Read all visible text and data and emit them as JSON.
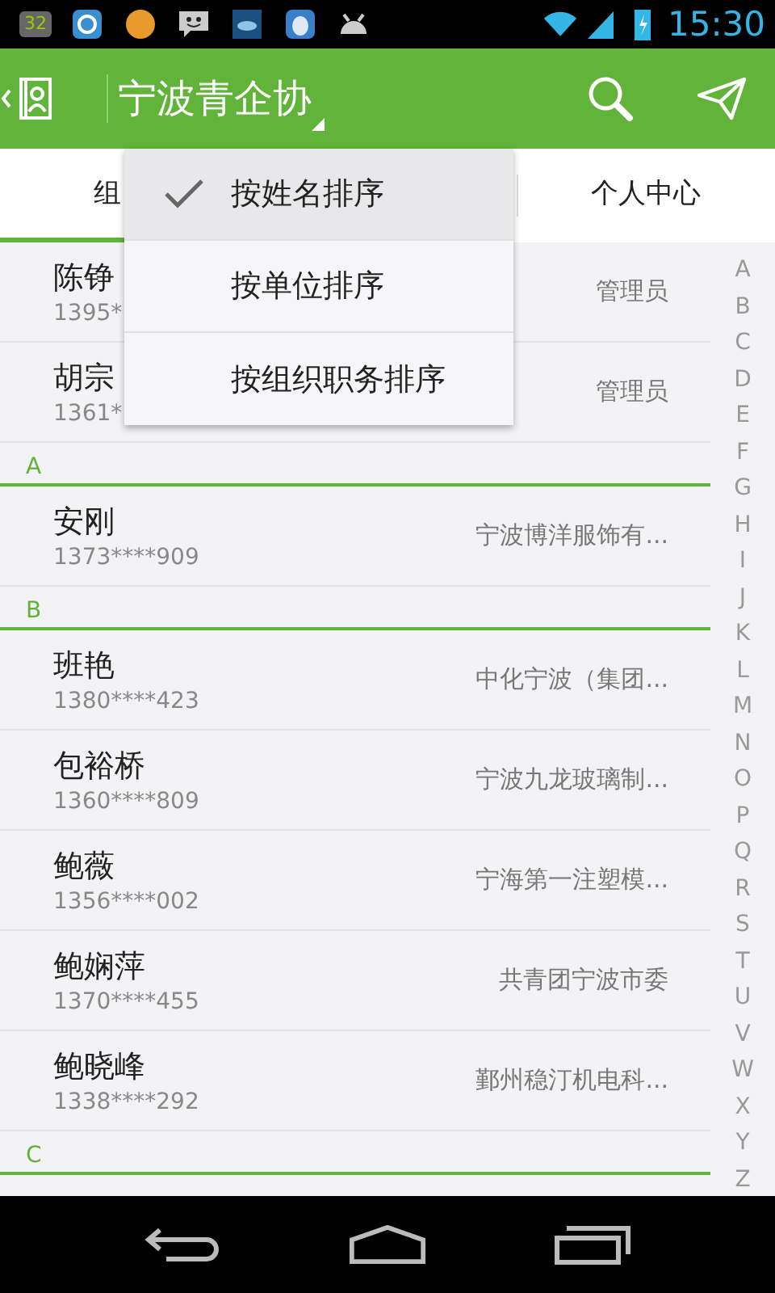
{
  "status_bar": {
    "time": "15:30",
    "battery_badge": "32"
  },
  "app_bar": {
    "title": "宁波青企协"
  },
  "tabs": [
    {
      "label": "组",
      "selected": true
    },
    {
      "label": "个人中心",
      "selected": false
    }
  ],
  "sort_menu": [
    {
      "label": "按姓名排序",
      "selected": true
    },
    {
      "label": "按单位排序",
      "selected": false
    },
    {
      "label": "按组织职务排序",
      "selected": false
    }
  ],
  "list": [
    {
      "kind": "person",
      "name": "陈铮",
      "phone": "1395*",
      "detail": "管理员"
    },
    {
      "kind": "person",
      "name": "胡宗",
      "phone": "1361*",
      "detail": "管理员"
    },
    {
      "kind": "header",
      "letter": "A"
    },
    {
      "kind": "person",
      "name": "安刚",
      "phone": "1373****909",
      "detail": "宁波博洋服饰有..."
    },
    {
      "kind": "header",
      "letter": "B"
    },
    {
      "kind": "person",
      "name": "班艳",
      "phone": "1380****423",
      "detail": "中化宁波（集团..."
    },
    {
      "kind": "person",
      "name": "包裕桥",
      "phone": "1360****809",
      "detail": "宁波九龙玻璃制..."
    },
    {
      "kind": "person",
      "name": "鲍薇",
      "phone": "1356****002",
      "detail": "宁海第一注塑模..."
    },
    {
      "kind": "person",
      "name": "鲍娴萍",
      "phone": "1370****455",
      "detail": "共青团宁波市委"
    },
    {
      "kind": "person",
      "name": "鲍晓峰",
      "phone": "1338****292",
      "detail": "鄞州稳汀机电科..."
    },
    {
      "kind": "header",
      "letter": "C"
    }
  ],
  "index_letters": [
    "A",
    "B",
    "C",
    "D",
    "E",
    "F",
    "G",
    "H",
    "I",
    "J",
    "K",
    "L",
    "M",
    "N",
    "O",
    "P",
    "Q",
    "R",
    "S",
    "T",
    "U",
    "V",
    "W",
    "X",
    "Y",
    "Z"
  ]
}
